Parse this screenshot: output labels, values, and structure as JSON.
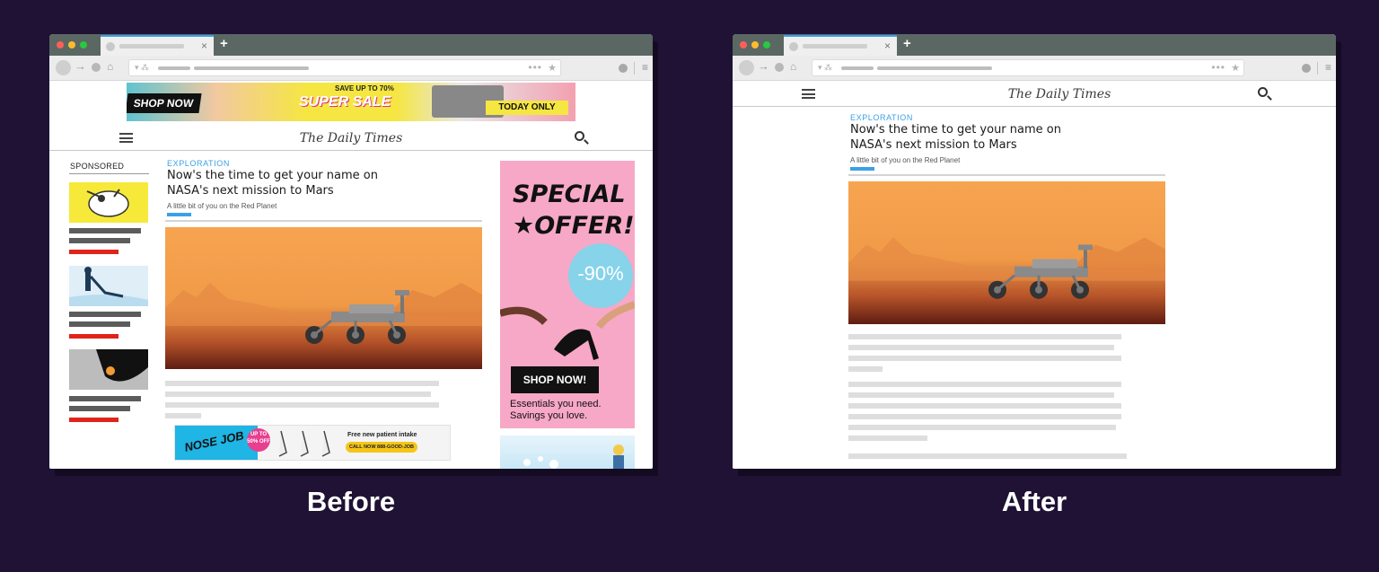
{
  "colors": {
    "background": "#1f1235",
    "accent_blue": "#3aa0e8",
    "sponsored_red": "#e0241b",
    "mars_orange": "#f7a450"
  },
  "browser": {
    "tab_close": "×",
    "new_tab": "+",
    "nav_forward": "→",
    "nav_home": "⌂",
    "url_icons": "▾ ⁂",
    "url_more": "•••",
    "url_star": "★",
    "menu": "≡"
  },
  "site": {
    "title": "The Daily Times"
  },
  "article": {
    "category": "EXPLORATION",
    "title": "Now's the time to get your name on NASA's next mission to Mars",
    "subtitle": "A little bit of you on the Red Planet"
  },
  "ads": {
    "top_banner": {
      "shop_now": "SHOP NOW",
      "save_up": "SAVE UP TO 70%",
      "super_sale": "SUPER SALE",
      "today_only": "TODAY ONLY"
    },
    "sponsored_label": "SPONSORED",
    "side": {
      "special": "SPECIAL ★OFFER!",
      "discount": "-90%",
      "shop_now": "SHOP NOW!",
      "tagline_1": "Essentials you need.",
      "tagline_2": "Savings you love."
    },
    "bottom": {
      "nose_job": "NOSE JOB",
      "offer": "UP TO 50% OFF",
      "intake": "Free new patient intake",
      "call": "CALL NOW 888-GOOD-JOB"
    }
  },
  "captions": {
    "before": "Before",
    "after": "After"
  }
}
